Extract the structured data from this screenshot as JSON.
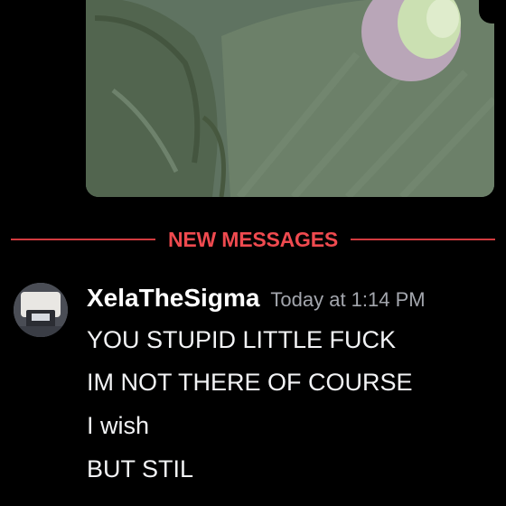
{
  "divider": {
    "label": "NEW MESSAGES",
    "color": "#ef4a4f"
  },
  "message": {
    "author": "XelaTheSigma",
    "timestamp": "Today at 1:14 PM",
    "lines": [
      "YOU STUPID LITTLE FUCK",
      "IM NOT THERE OF COURSE",
      "I wish",
      "BUT STIL"
    ]
  },
  "colors": {
    "background": "#000000",
    "text": "#f2f3f5",
    "timestamp": "#a3a6ad",
    "new_messages_red": "#d13a3f"
  }
}
